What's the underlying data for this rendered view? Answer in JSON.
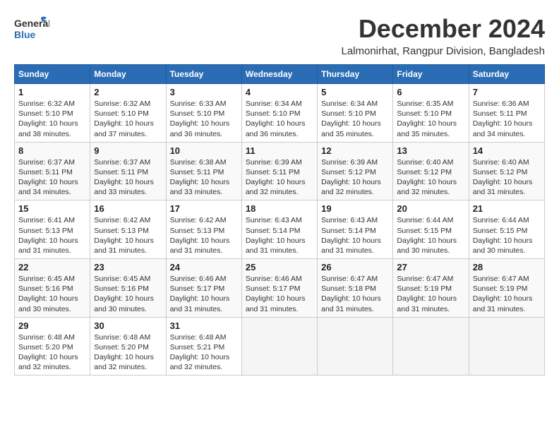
{
  "logo": {
    "line1": "General",
    "line2": "Blue"
  },
  "title": "December 2024",
  "location": "Lalmonirhat, Rangpur Division, Bangladesh",
  "days_header": [
    "Sunday",
    "Monday",
    "Tuesday",
    "Wednesday",
    "Thursday",
    "Friday",
    "Saturday"
  ],
  "weeks": [
    [
      {
        "day": "1",
        "sunrise": "6:32 AM",
        "sunset": "5:10 PM",
        "daylight": "10 hours and 38 minutes."
      },
      {
        "day": "2",
        "sunrise": "6:32 AM",
        "sunset": "5:10 PM",
        "daylight": "10 hours and 37 minutes."
      },
      {
        "day": "3",
        "sunrise": "6:33 AM",
        "sunset": "5:10 PM",
        "daylight": "10 hours and 36 minutes."
      },
      {
        "day": "4",
        "sunrise": "6:34 AM",
        "sunset": "5:10 PM",
        "daylight": "10 hours and 36 minutes."
      },
      {
        "day": "5",
        "sunrise": "6:34 AM",
        "sunset": "5:10 PM",
        "daylight": "10 hours and 35 minutes."
      },
      {
        "day": "6",
        "sunrise": "6:35 AM",
        "sunset": "5:10 PM",
        "daylight": "10 hours and 35 minutes."
      },
      {
        "day": "7",
        "sunrise": "6:36 AM",
        "sunset": "5:11 PM",
        "daylight": "10 hours and 34 minutes."
      }
    ],
    [
      {
        "day": "8",
        "sunrise": "6:37 AM",
        "sunset": "5:11 PM",
        "daylight": "10 hours and 34 minutes."
      },
      {
        "day": "9",
        "sunrise": "6:37 AM",
        "sunset": "5:11 PM",
        "daylight": "10 hours and 33 minutes."
      },
      {
        "day": "10",
        "sunrise": "6:38 AM",
        "sunset": "5:11 PM",
        "daylight": "10 hours and 33 minutes."
      },
      {
        "day": "11",
        "sunrise": "6:39 AM",
        "sunset": "5:11 PM",
        "daylight": "10 hours and 32 minutes."
      },
      {
        "day": "12",
        "sunrise": "6:39 AM",
        "sunset": "5:12 PM",
        "daylight": "10 hours and 32 minutes."
      },
      {
        "day": "13",
        "sunrise": "6:40 AM",
        "sunset": "5:12 PM",
        "daylight": "10 hours and 32 minutes."
      },
      {
        "day": "14",
        "sunrise": "6:40 AM",
        "sunset": "5:12 PM",
        "daylight": "10 hours and 31 minutes."
      }
    ],
    [
      {
        "day": "15",
        "sunrise": "6:41 AM",
        "sunset": "5:13 PM",
        "daylight": "10 hours and 31 minutes."
      },
      {
        "day": "16",
        "sunrise": "6:42 AM",
        "sunset": "5:13 PM",
        "daylight": "10 hours and 31 minutes."
      },
      {
        "day": "17",
        "sunrise": "6:42 AM",
        "sunset": "5:13 PM",
        "daylight": "10 hours and 31 minutes."
      },
      {
        "day": "18",
        "sunrise": "6:43 AM",
        "sunset": "5:14 PM",
        "daylight": "10 hours and 31 minutes."
      },
      {
        "day": "19",
        "sunrise": "6:43 AM",
        "sunset": "5:14 PM",
        "daylight": "10 hours and 31 minutes."
      },
      {
        "day": "20",
        "sunrise": "6:44 AM",
        "sunset": "5:15 PM",
        "daylight": "10 hours and 30 minutes."
      },
      {
        "day": "21",
        "sunrise": "6:44 AM",
        "sunset": "5:15 PM",
        "daylight": "10 hours and 30 minutes."
      }
    ],
    [
      {
        "day": "22",
        "sunrise": "6:45 AM",
        "sunset": "5:16 PM",
        "daylight": "10 hours and 30 minutes."
      },
      {
        "day": "23",
        "sunrise": "6:45 AM",
        "sunset": "5:16 PM",
        "daylight": "10 hours and 30 minutes."
      },
      {
        "day": "24",
        "sunrise": "6:46 AM",
        "sunset": "5:17 PM",
        "daylight": "10 hours and 31 minutes."
      },
      {
        "day": "25",
        "sunrise": "6:46 AM",
        "sunset": "5:17 PM",
        "daylight": "10 hours and 31 minutes."
      },
      {
        "day": "26",
        "sunrise": "6:47 AM",
        "sunset": "5:18 PM",
        "daylight": "10 hours and 31 minutes."
      },
      {
        "day": "27",
        "sunrise": "6:47 AM",
        "sunset": "5:19 PM",
        "daylight": "10 hours and 31 minutes."
      },
      {
        "day": "28",
        "sunrise": "6:47 AM",
        "sunset": "5:19 PM",
        "daylight": "10 hours and 31 minutes."
      }
    ],
    [
      {
        "day": "29",
        "sunrise": "6:48 AM",
        "sunset": "5:20 PM",
        "daylight": "10 hours and 32 minutes."
      },
      {
        "day": "30",
        "sunrise": "6:48 AM",
        "sunset": "5:20 PM",
        "daylight": "10 hours and 32 minutes."
      },
      {
        "day": "31",
        "sunrise": "6:48 AM",
        "sunset": "5:21 PM",
        "daylight": "10 hours and 32 minutes."
      },
      null,
      null,
      null,
      null
    ]
  ]
}
